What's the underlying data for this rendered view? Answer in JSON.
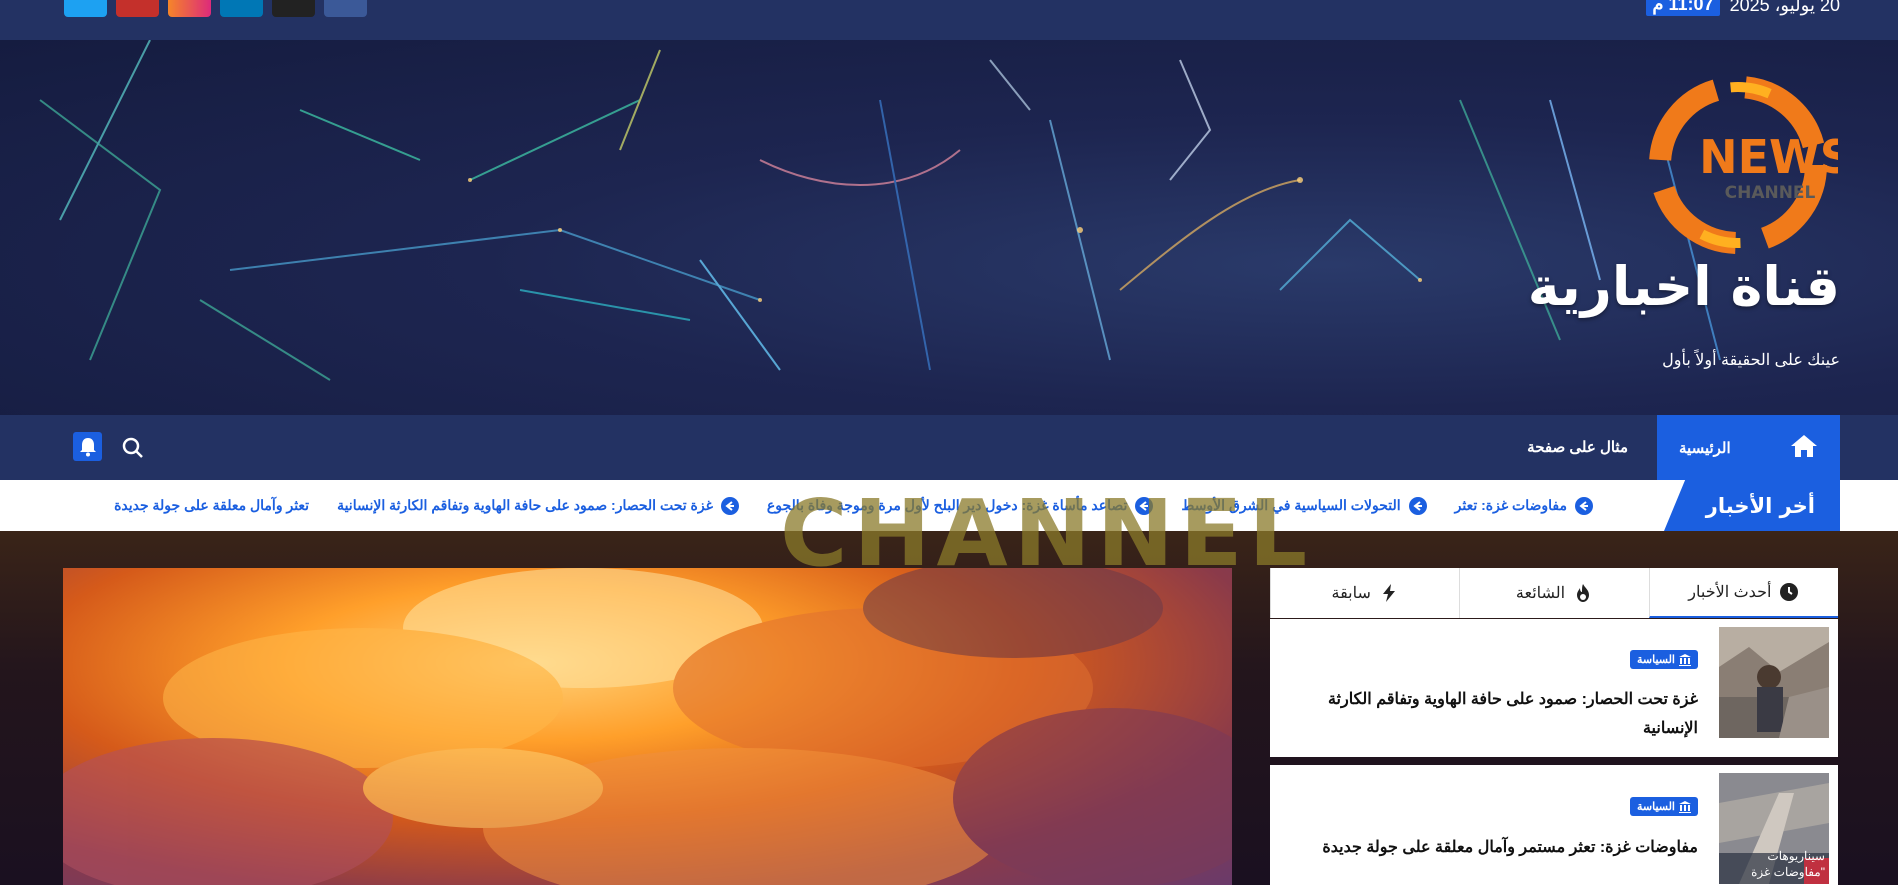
{
  "topbar": {
    "date": "20 يوليو، 2025",
    "time": "11:07 م",
    "social_icons": [
      {
        "name": "twitter-icon",
        "color": "#1da1f2"
      },
      {
        "name": "youtube-icon",
        "color": "#c4302b"
      },
      {
        "name": "instagram-icon",
        "color": "#e1306c"
      },
      {
        "name": "linkedin-icon",
        "color": "#0077b5"
      },
      {
        "name": "x-icon",
        "color": "#222222"
      },
      {
        "name": "facebook-icon",
        "color": "#3b5998"
      }
    ]
  },
  "header": {
    "logo_text_main": "NEWS",
    "logo_text_sub": "CHANNEL",
    "site_title": "قناة اخبارية",
    "tagline": "عينك على الحقيقة أولاً بأول"
  },
  "nav": {
    "home_label": "الرئيسية",
    "page_link": "مثال على صفحة"
  },
  "ticker": {
    "label": "أخر الأخبار",
    "items": [
      "تعثر وآمال معلقة على جولة جديدة",
      "غزة تحت الحصار: صمود على حافة الهاوية وتفاقم الكارثة الإنسانية",
      "تصاعد مأساة غزة: دخول دير البلح لأول مرة وموجة وفاة بالجوع",
      "التحولات السياسية في الشرق الأوسط",
      "مفاوضات غزة: تعثر"
    ]
  },
  "background": {
    "watermark": "CHANNEL"
  },
  "sidebar": {
    "tabs": [
      {
        "label": "أحدث الأخبار",
        "icon": "clock-icon"
      },
      {
        "label": "الشائعة",
        "icon": "fire-icon"
      },
      {
        "label": "سابقة",
        "icon": "bolt-icon"
      }
    ],
    "posts": [
      {
        "category": "السياسة",
        "title": "غزة تحت الحصار: صمود على حافة الهاوية وتفاقم الكارثة الإنسانية"
      },
      {
        "category": "السياسة",
        "title": "مفاوضات غزة: تعثر مستمر وآمال معلقة على جولة جديدة",
        "thumb_caption": "سيناريوهات \"مفاوضات غزة"
      }
    ]
  },
  "colors": {
    "accent": "#1b5fe0",
    "navbar": "#233263"
  }
}
